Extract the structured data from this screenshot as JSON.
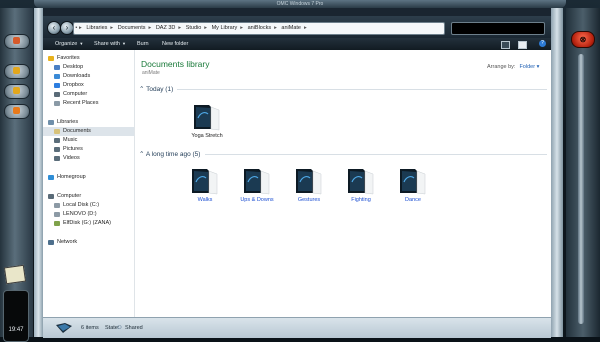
{
  "window": {
    "title": "OMC Windows 7 Pro"
  },
  "left_dock": {
    "time": "19:47"
  },
  "nav": {
    "breadcrumb": [
      "Libraries",
      "Documents",
      "DAZ 3D",
      "Studio",
      "My Library",
      "aniBlocks",
      "aniMate"
    ],
    "back_icon": "back-arrow-icon",
    "forward_icon": "forward-arrow-icon"
  },
  "toolbar": {
    "organize": "Organize",
    "share_with": "Share with",
    "burn": "Burn",
    "new_folder": "New folder",
    "help": "?"
  },
  "nav_pane": {
    "favorites_header": "Favorites",
    "favorites": [
      "Desktop",
      "Downloads",
      "Dropbox",
      "Computer",
      "Recent Places"
    ],
    "libraries_header": "Libraries",
    "libraries": [
      "Documents",
      "Music",
      "Pictures",
      "Videos"
    ],
    "homegroup": "Homegroup",
    "computer_header": "Computer",
    "drives": [
      "Local Disk (C:)",
      "LENOVO (D:)",
      "ElfDisk (G:) (ZANA)"
    ],
    "network": "Network"
  },
  "content": {
    "library_title": "Documents library",
    "library_subtitle": "aniMate",
    "arrange_label": "Arrange by:",
    "arrange_value": "Folder",
    "groups": [
      {
        "header": "Today (1)",
        "items": [
          "Yoga Stretch"
        ]
      },
      {
        "header": "A long time ago (5)",
        "items": [
          "Walks",
          "Ups & Downs",
          "Gestures",
          "Fighting",
          "Dance"
        ]
      }
    ]
  },
  "status": {
    "count": "6 items",
    "state_label": "State:",
    "state_value": "Shared"
  },
  "colors": {
    "accent_green": "#1a7a3a",
    "link_blue": "#1c4fd2",
    "close_red": "#d2301a"
  }
}
